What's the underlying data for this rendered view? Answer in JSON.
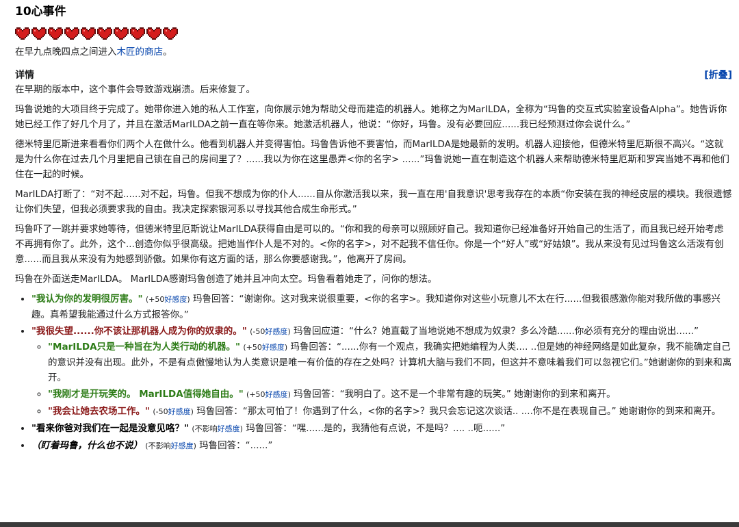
{
  "event": {
    "title": "10心事件",
    "hearts_count": 10,
    "heart_color": "#d41c1c",
    "trigger_prefix": "在早九点晚四点之间进入",
    "trigger_link": "木匠的商店",
    "trigger_suffix": "。"
  },
  "details": {
    "title": "详情",
    "toggle_label": "[折叠]",
    "paragraphs": [
      "在早期的版本中，这个事件会导致游戏崩溃。后来修复了。",
      "玛鲁说她的大项目终于完成了。她带你进入她的私人工作室，向你展示她为帮助父母而建造的机器人。她称之为MarILDA，全称为“玛鲁的交互式实验室设备Alpha”。她告诉你她已经工作了好几个月了，并且在激活MarILDA之前一直在等你来。她激活机器人，他说：“你好，玛鲁。没有必要回应......我已经预测过你会说什么。”",
      "德米特里厄斯进来看看你们两个人在做什么。他看到机器人并变得害怕。玛鲁告诉他不要害怕，而MarILDA是她最新的发明。机器人迎接他，但德米特里厄斯很不高兴。“这就是为什么你在过去几个月里把自己锁在自己的房间里了？......我以为你在这里愚弄<你的名字> ......”玛鲁说她一直在制造这个机器人来帮助德米特里厄斯和罗宾当她不再和他们住在一起的时候。",
      "MarILDA打断了：“对不起......对不起，玛鲁。但我不想成为你的仆人......自从你激活我以来，我一直在用'自我意识'思考我存在的本质“你安装在我的神经皮层的模块。我很遗憾让你们失望，但我必须要求我的自由。我决定探索银河系以寻找其他合成生命形式。”",
      "玛鲁吓了一跳并要求她等待，但德米特里厄斯说让MarILDA获得自由是可以的。“你和我的母亲可以照顾好自己。我知道你已经准备好开始自己的生活了，而且我已经开始考虑不再拥有你了。此外，这个...创造你似乎很高级。把她当作仆人是不对的。<你的名字>，对不起我不信任你。你是一个“好人”或“好姑娘”。我从来没有见过玛鲁这么活泼有创意......而且我从来没有为她感到骄傲。如果你有这方面的话，那么你要感谢我。”，他离开了房间。",
      "玛鲁在外面送走MarILDA。 MarILDA感谢玛鲁创造了她并且冲向太空。玛鲁看着她走了，问你的想法。"
    ],
    "choices": [
      {
        "choice": "\"我认为你的发明很厉害。\"",
        "tone": "pos",
        "effect": "(+50",
        "effect_link": "好感度",
        "effect_end": ")",
        "response": " 玛鲁回答：“谢谢你。这对我来说很重要，<你的名字>。我知道你对这些小玩意儿不太在行......但我很感激你能对我所做的事感兴趣。真希望我能通过什么方式报答你。”"
      },
      {
        "choice": "\"我很失望......你不该让那机器人成为你的奴隶的。\"",
        "tone": "neg",
        "effect": "(-50",
        "effect_link": "好感度",
        "effect_end": ")",
        "response": " 玛鲁回应道：“什么？她直截了当地说她不想成为奴隶？多么冷酷......你必须有充分的理由说出......”"
      }
    ],
    "subchoices": [
      {
        "choice": "\"MarILDA只是一种旨在为人类行动的机器。\"",
        "tone": "pos",
        "effect": "(+50",
        "effect_link": "好感度",
        "effect_end": ")",
        "response": " 玛鲁回答：“......你有一个观点，我确实把她编程为人类.... ..但是她的神经网络是如此复杂，我不能确定自己的意识并没有出现。此外，不是有点傲慢地认为人类意识是唯一有价值的存在之处吗？计算机大脑与我们不同，但这并不意味着我们可以忽视它们。”她谢谢你的到来和离开。"
      },
      {
        "choice": "\"我刚才是开玩笑的。 MarILDA值得她自由。\"",
        "tone": "pos",
        "effect": "(+50",
        "effect_link": "好感度",
        "effect_end": ")",
        "response": " 玛鲁回答：“我明白了。这不是一个非常有趣的玩笑。” 她谢谢你的到来和离开。"
      },
      {
        "choice": "\"我会让她去农场工作。\"",
        "tone": "neg",
        "effect": "(-50",
        "effect_link": "好感度",
        "effect_end": ")",
        "response": " 玛鲁回答：“那太可怕了！你遇到了什么，<你的名字>？我只会忘记这次谈话.. ....你不是在表现自己。” 她谢谢你的到来和离开。"
      }
    ],
    "choices_tail": [
      {
        "choice": "\"看来你爸对我们在一起是没意见咯？\"",
        "tone": "neu",
        "effect": "(不影响",
        "effect_link": "好感度",
        "effect_end": ")",
        "response": " 玛鲁回答：“嘿......是的，我猜他有点说，不是吗？.... ..呃......”"
      },
      {
        "choice": "（盯着玛鲁，什么也不说）",
        "tone": "neu-italic",
        "effect": "(不影响",
        "effect_link": "好感度",
        "effect_end": ")",
        "response": " 玛鲁回答：“......”"
      }
    ]
  }
}
